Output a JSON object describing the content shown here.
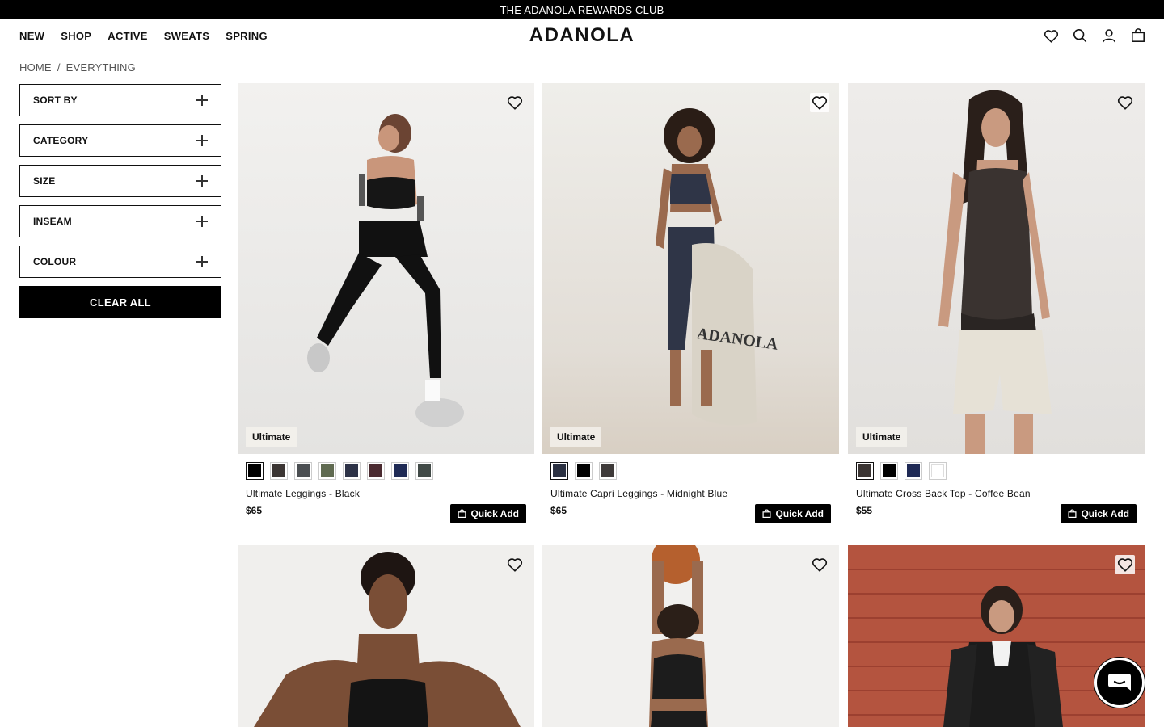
{
  "announcement": "THE ADANOLA REWARDS CLUB",
  "nav": [
    "NEW",
    "SHOP",
    "ACTIVE",
    "SWEATS",
    "SPRING"
  ],
  "logo": "ADANOLA",
  "header_icons": [
    "heart-icon",
    "search-icon",
    "account-icon",
    "bag-icon"
  ],
  "breadcrumb": {
    "home": "HOME",
    "separator": "/",
    "current": "EVERYTHING"
  },
  "filters": [
    "SORT BY",
    "CATEGORY",
    "SIZE",
    "INSEAM",
    "COLOUR"
  ],
  "clear_all": "CLEAR ALL",
  "quick_add_label": "Quick Add",
  "products": [
    {
      "tag": "Ultimate",
      "name": "Ultimate Leggings - Black",
      "price": "$65",
      "swatches": [
        "#000000",
        "#3b3533",
        "#4b4f52",
        "#5f6a50",
        "#2d3247",
        "#4a2a30",
        "#1f2a55",
        "#414a47"
      ]
    },
    {
      "tag": "Ultimate",
      "name": "Ultimate Capri Leggings - Midnight Blue",
      "price": "$65",
      "swatches": [
        "#2b3142",
        "#000000",
        "#3e3a39"
      ]
    },
    {
      "tag": "Ultimate",
      "name": "Ultimate Cross Back Top - Coffee Bean",
      "price": "$55",
      "swatches": [
        "#3b3533",
        "#000000",
        "#1f2a55",
        "#ffffff"
      ]
    }
  ],
  "colors": {
    "accent": "#000000",
    "background": "#ffffff",
    "tag_bg": "#f5f2ee"
  }
}
